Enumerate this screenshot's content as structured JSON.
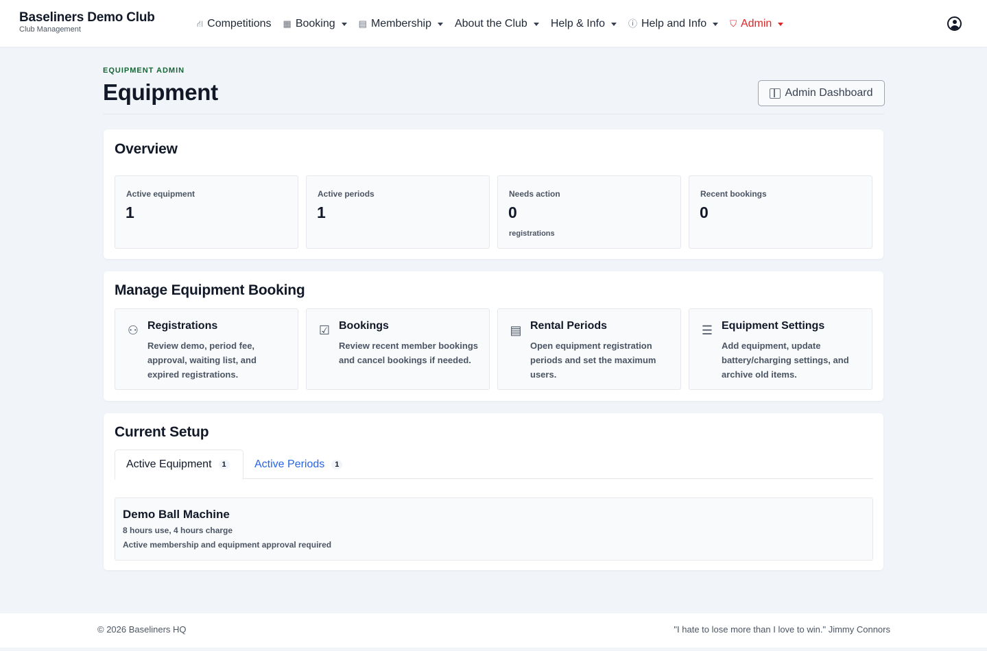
{
  "brand": {
    "title": "Baseliners Demo Club",
    "subtitle": "Club Management"
  },
  "nav": {
    "items": [
      {
        "label": "Competitions",
        "icon": "sitemap-icon",
        "glyph": "⛙",
        "dropdown": false
      },
      {
        "label": "Booking",
        "icon": "calendar-icon",
        "glyph": "▦",
        "dropdown": true
      },
      {
        "label": "Membership",
        "icon": "id-card-icon",
        "glyph": "▤",
        "dropdown": true
      },
      {
        "label": "About the Club",
        "icon": "",
        "glyph": "",
        "dropdown": true
      },
      {
        "label": "Help & Info",
        "icon": "",
        "glyph": "",
        "dropdown": true
      },
      {
        "label": "Help and Info",
        "icon": "info-circle-icon",
        "glyph": "ⓘ",
        "dropdown": true
      },
      {
        "label": "Admin",
        "icon": "shield-icon",
        "glyph": "⛉",
        "dropdown": true
      }
    ],
    "user_icon": "user-circle-icon"
  },
  "header": {
    "eyebrow": "EQUIPMENT ADMIN",
    "title": "Equipment",
    "admin_dashboard_label": "Admin Dashboard"
  },
  "overview": {
    "title": "Overview",
    "stats": [
      {
        "label": "Active equipment",
        "value": "1",
        "sub": ""
      },
      {
        "label": "Active periods",
        "value": "1",
        "sub": ""
      },
      {
        "label": "Needs action",
        "value": "0",
        "sub": "registrations"
      },
      {
        "label": "Recent bookings",
        "value": "0",
        "sub": ""
      }
    ]
  },
  "manage": {
    "title": "Manage Equipment Booking",
    "tiles": [
      {
        "title": "Registrations",
        "desc": "Review demo, period fee, approval, waiting list, and expired registrations.",
        "icon": "user-check-icon",
        "glyph": "⚇"
      },
      {
        "title": "Bookings",
        "desc": "Review recent member bookings and cancel bookings if needed.",
        "icon": "calendar-check-icon",
        "glyph": "☑"
      },
      {
        "title": "Rental Periods",
        "desc": "Open equipment registration periods and set the maximum users.",
        "icon": "calendar-range-icon",
        "glyph": "▤"
      },
      {
        "title": "Equipment Settings",
        "desc": "Add equipment, update battery/charging settings, and archive old items.",
        "icon": "sliders-icon",
        "glyph": "☰"
      }
    ]
  },
  "setup": {
    "title": "Current Setup",
    "tabs": [
      {
        "label": "Active Equipment",
        "count": "1"
      },
      {
        "label": "Active Periods",
        "count": "1"
      }
    ],
    "items": [
      {
        "name": "Demo Ball Machine",
        "meta": "8 hours use, 4 hours charge",
        "requirement": "Active membership and equipment approval required"
      }
    ]
  },
  "footer": {
    "copyright": "© 2026 Baseliners HQ",
    "quote": "\"I hate to lose more than I love to win.\" Jimmy Connors"
  }
}
